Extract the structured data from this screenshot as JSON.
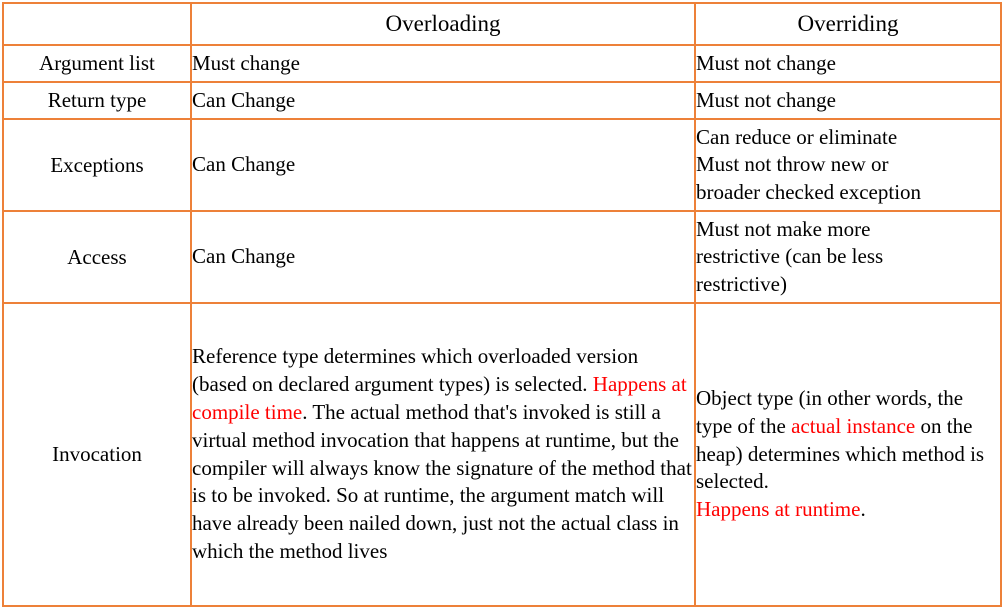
{
  "table": {
    "title": "Overloading vs Overriding comparison table",
    "border_color": "#ED8139",
    "highlight_color": "#FF0000",
    "text_color": "#000000",
    "background_color": "#FFFFFF",
    "headers": {
      "corner": "",
      "overloading": "Overloading",
      "overriding": "Overriding"
    },
    "rows": [
      {
        "label": "Argument list",
        "overloading": "Must change",
        "overriding": "Must not change"
      },
      {
        "label": "Return type",
        "overloading": "Can Change",
        "overriding": "Must not change"
      },
      {
        "label": "Exceptions",
        "overloading": "Can Change",
        "overriding": "Can reduce or eliminate\nMust not throw new or\nbroader checked exception"
      },
      {
        "label": "Access",
        "overloading": "Can Change",
        "overriding": "Must not make more\nrestrictive (can be less\nrestrictive)"
      },
      {
        "label": "Invocation",
        "overloading_parts": {
          "before": "Reference type determines which overloaded version (based on declared argument types) is selected. ",
          "highlight": "Happens at compile time",
          "after": ". The actual method that's invoked is still a virtual method invocation that happens at runtime, but the compiler will always know the signature of the method that is to be invoked. So at runtime, the argument match will have already been nailed down, just not the actual class in which the method lives"
        },
        "overriding_parts": {
          "p1_before": "Object type (in other words, the type of the ",
          "p1_highlight": "actual instance",
          "p1_after": " on the heap) determines which method is selected.",
          "p2_highlight": "Happens at runtime",
          "p2_after": "."
        }
      }
    ]
  }
}
